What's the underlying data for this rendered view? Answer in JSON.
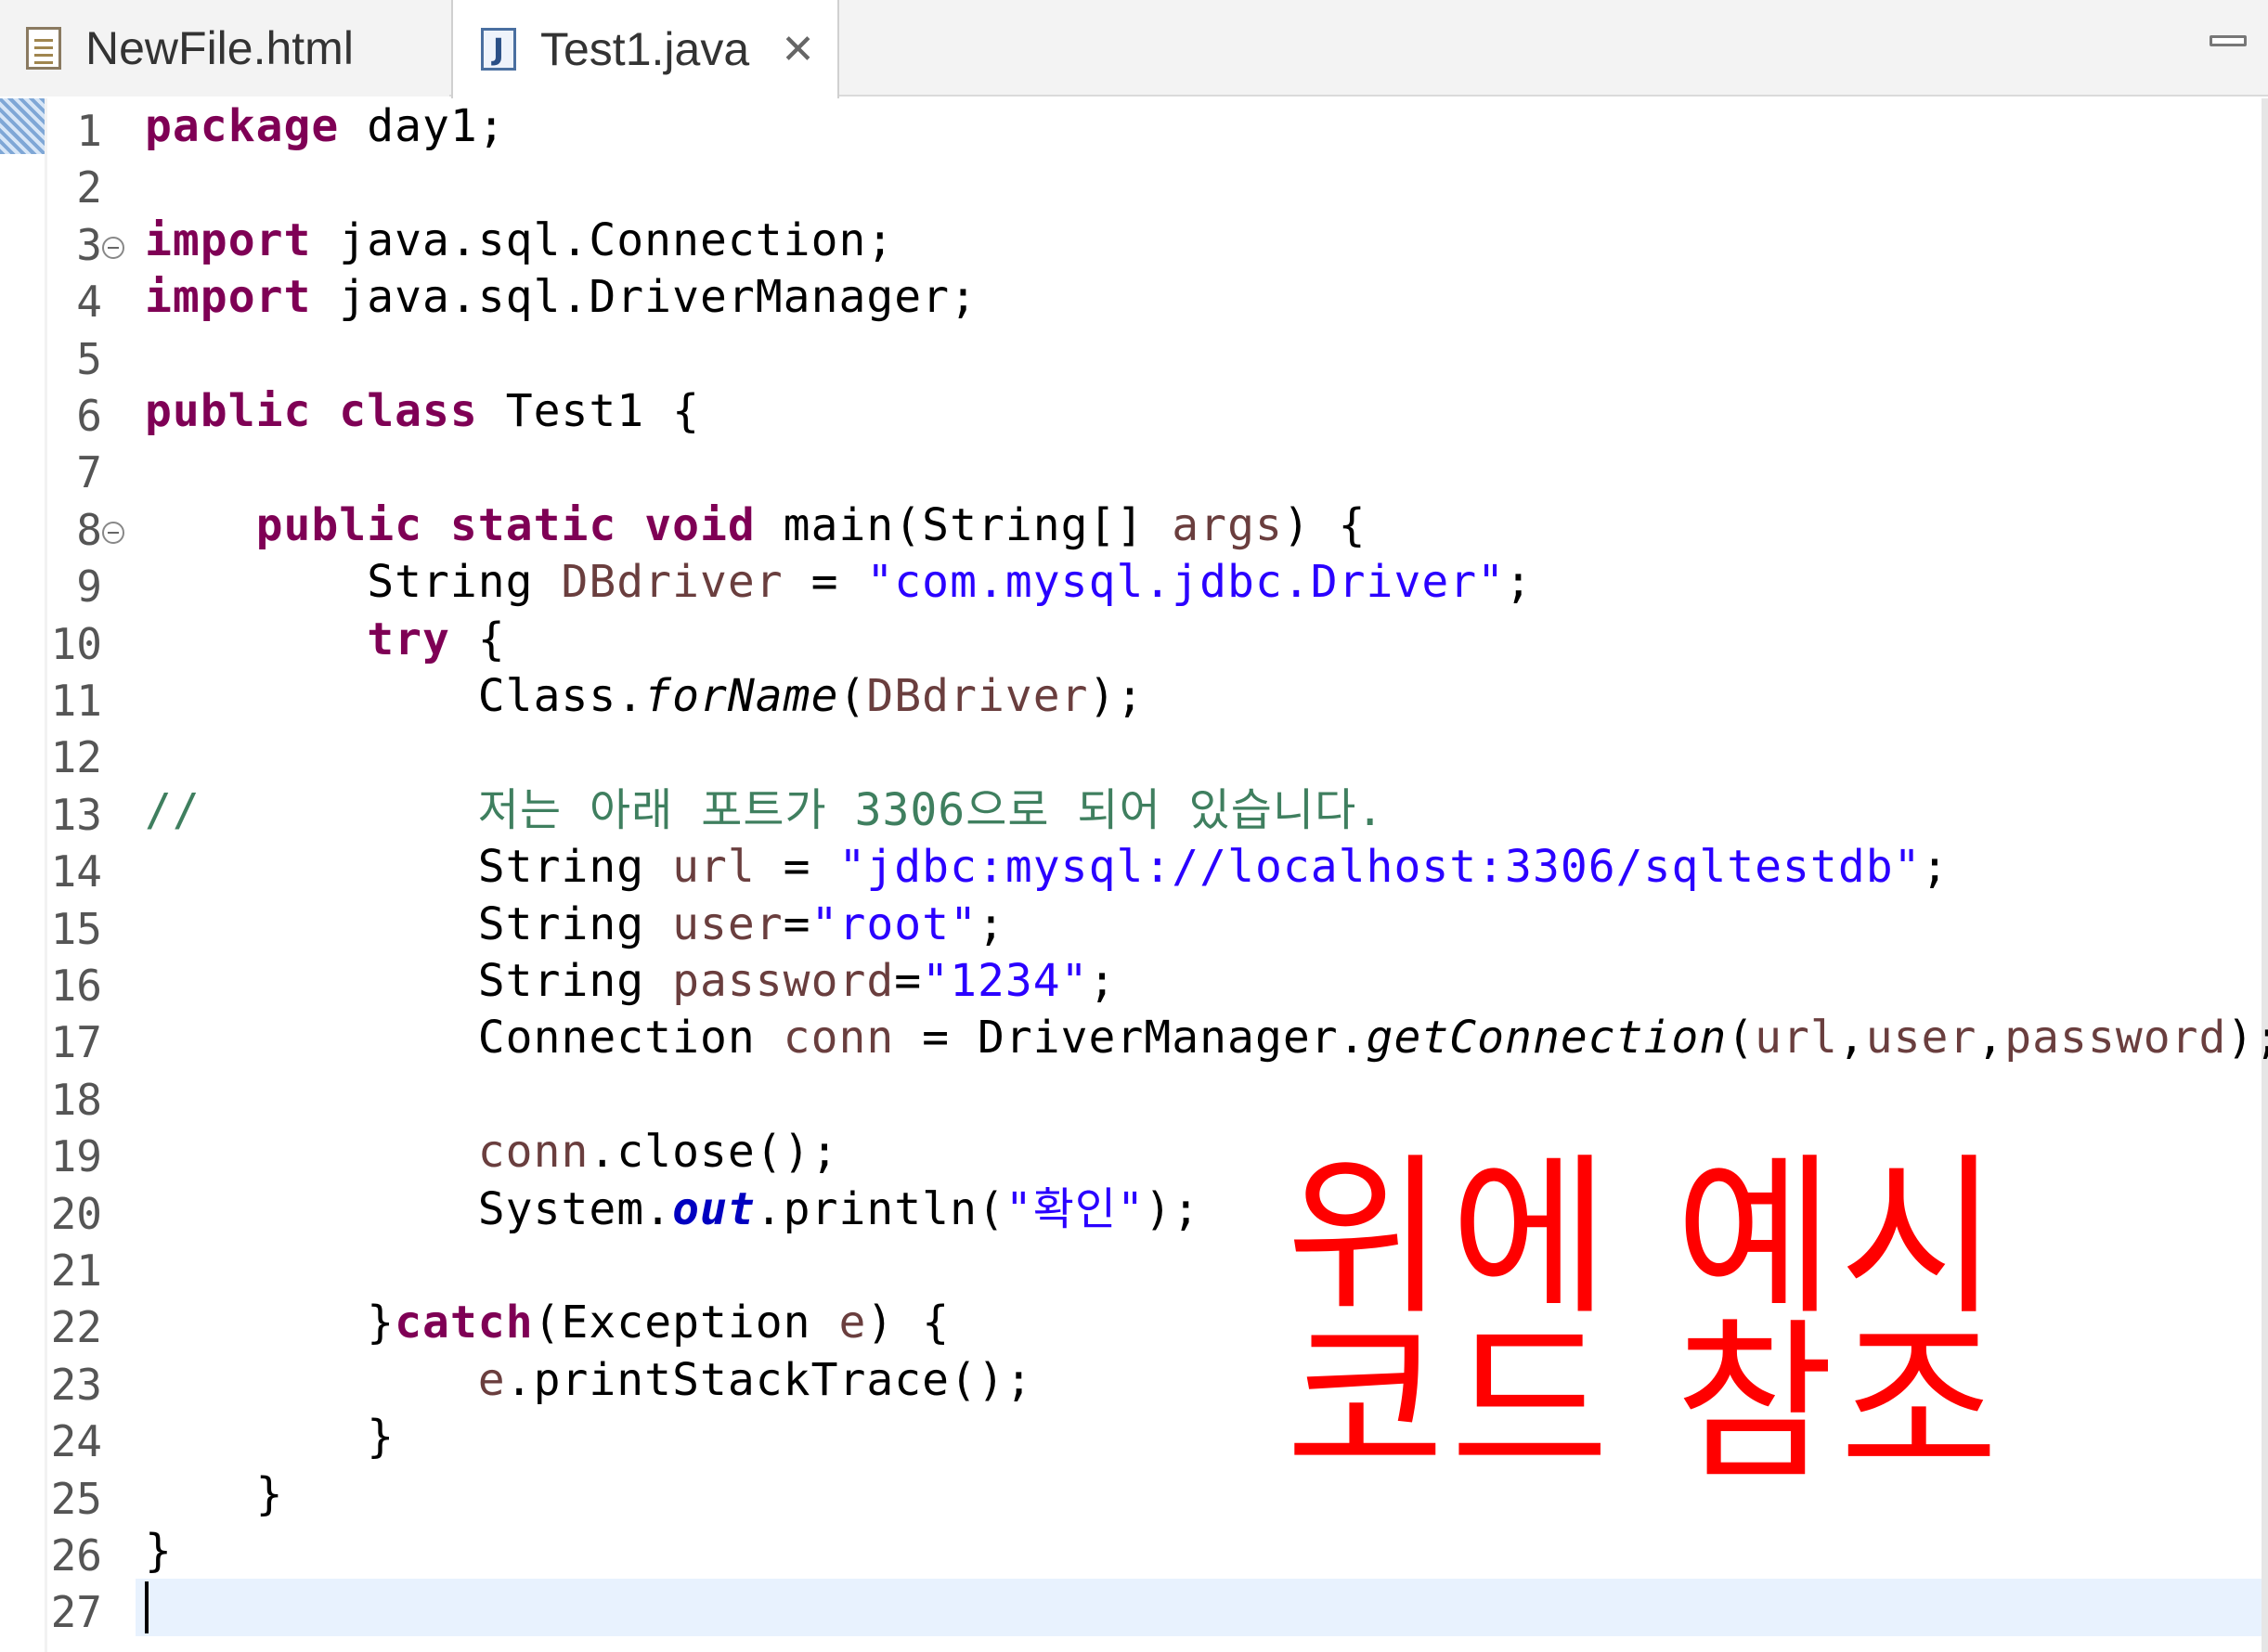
{
  "tabs": [
    {
      "label": "NewFile.html",
      "icon": "html-file-icon",
      "active": false
    },
    {
      "label": "Test1.java",
      "icon": "java-file-icon",
      "active": true,
      "close_icon": "close-icon"
    }
  ],
  "window_controls": {
    "minimize_icon": "minimize-icon"
  },
  "editor": {
    "line_numbers": [
      "1",
      "2",
      "3",
      "4",
      "5",
      "6",
      "7",
      "8",
      "9",
      "10",
      "11",
      "12",
      "13",
      "14",
      "15",
      "16",
      "17",
      "18",
      "19",
      "20",
      "21",
      "22",
      "23",
      "24",
      "25",
      "26",
      "27"
    ],
    "t": {
      "package": "package",
      "day1": " day1;",
      "import": "import",
      "imp1": " java.sql.Connection;",
      "imp2": " java.sql.DriverManager;",
      "public": "public",
      "class": "class",
      "cls_rest": " Test1 {",
      "static": "static",
      "void": "void",
      "main_a": " main(String[] ",
      "args": "args",
      "main_b": ") {",
      "l9_a": "        String ",
      "l9_var": "DBdriver",
      "l9_b": " = ",
      "l9_str": "\"com.mysql.jdbc.Driver\"",
      "l9_c": ";",
      "l10_ind": "        ",
      "try": "try",
      "l10_b": " {",
      "l11_a": "            Class.",
      "l11_m": "forName",
      "l11_b": "(",
      "l11_var": "DBdriver",
      "l11_c": ");",
      "l13_cm": "//          저는 아래 포트가 3306으로 되어 있습니다.",
      "l14_a": "            String ",
      "l14_var": "url",
      "l14_b": " = ",
      "l14_str": "\"jdbc:mysql://localhost:3306/sqltestdb\"",
      "l14_c": ";",
      "l15_a": "            String ",
      "l15_var": "user",
      "l15_b": "=",
      "l15_str": "\"root\"",
      "l15_c": ";",
      "l16_a": "            String ",
      "l16_var": "password",
      "l16_b": "=",
      "l16_str": "\"1234\"",
      "l16_c": ";",
      "l17_a": "            Connection ",
      "l17_var": "conn",
      "l17_b": " = DriverManager.",
      "l17_m": "getConnection",
      "l17_c": "(",
      "l17_v1": "url",
      "l17_comma1": ",",
      "l17_v2": "user",
      "l17_comma2": ",",
      "l17_v3": "password",
      "l17_d": ");",
      "l19_ind": "            ",
      "l19_var": "conn",
      "l19_b": ".close();",
      "l20_a": "            System.",
      "l20_fld": "out",
      "l20_b": ".println(",
      "l20_str": "\"확인\"",
      "l20_c": ");",
      "l22_a": "        }",
      "catch": "catch",
      "l22_b": "(Exception ",
      "l22_var": "e",
      "l22_c": ") {",
      "l23_ind": "            ",
      "l23_var": "e",
      "l23_b": ".printStackTrace();",
      "l24": "        }",
      "l25": "    }",
      "l26": "}"
    }
  },
  "overlay_note": {
    "line1": "위에 예시",
    "line2": "코드 참조",
    "color": "#ff0000"
  },
  "colors": {
    "keyword": "#7f0055",
    "string": "#2a00ff",
    "local_var": "#6a3e3e",
    "field": "#0000c0",
    "comment": "#3f7f5f",
    "current_line": "#e8f2fe"
  }
}
